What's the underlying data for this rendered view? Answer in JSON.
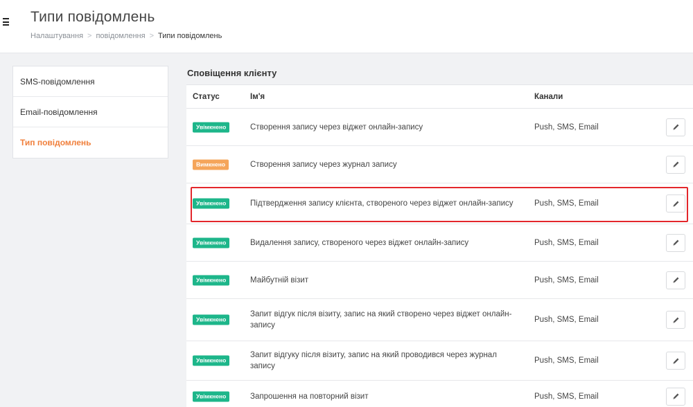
{
  "header": {
    "title": "Типи повідомлень",
    "breadcrumb": [
      "Налаштування",
      "повідомлення",
      "Типи повідомлень"
    ],
    "breadcrumb_separator": ">"
  },
  "sidebar": {
    "items": [
      {
        "label": "SMS-повідомлення",
        "active": false
      },
      {
        "label": "Email-повідомлення",
        "active": false
      },
      {
        "label": "Тип повідомлень",
        "active": true
      }
    ]
  },
  "section": {
    "title": "Сповіщення клієнту",
    "columns": {
      "status": "Статус",
      "name": "Ім'я",
      "channels": "Канали"
    }
  },
  "rows": [
    {
      "status": "Увімкнено",
      "enabled": true,
      "name": "Створення запису через віджет онлайн-запису",
      "channels": "Push, SMS, Email"
    },
    {
      "status": "Вимкнено",
      "enabled": false,
      "name": "Створення запису через журнал запису",
      "channels": ""
    },
    {
      "status": "Увімкнено",
      "enabled": true,
      "name": "Підтвердження запису клієнта, створеного через віджет онлайн-запису",
      "channels": "Push, SMS, Email",
      "highlighted": true
    },
    {
      "status": "Увімкнено",
      "enabled": true,
      "name": "Видалення запису, створеного через віджет онлайн-запису",
      "channels": "Push, SMS, Email"
    },
    {
      "status": "Увімкнено",
      "enabled": true,
      "name": "Майбутній візит",
      "channels": "Push, SMS, Email"
    },
    {
      "status": "Увімкнено",
      "enabled": true,
      "name": "Запит відгук після візиту, запис на який створено через віджет онлайн-запису",
      "channels": "Push, SMS, Email"
    },
    {
      "status": "Увімкнено",
      "enabled": true,
      "name": "Запит відгуку після візиту, запис на який проводився через журнал запису",
      "channels": "Push, SMS, Email"
    },
    {
      "status": "Увімкнено",
      "enabled": true,
      "name": "Запрошення на повторний візит",
      "channels": "Push, SMS, Email"
    }
  ],
  "icons": {
    "menu": "hamburger-icon",
    "edit": "pencil-icon"
  },
  "colors": {
    "enabled": "#1db68a",
    "disabled": "#f5a55a",
    "active_link": "#f07f3b",
    "highlight": "#e3262b"
  }
}
